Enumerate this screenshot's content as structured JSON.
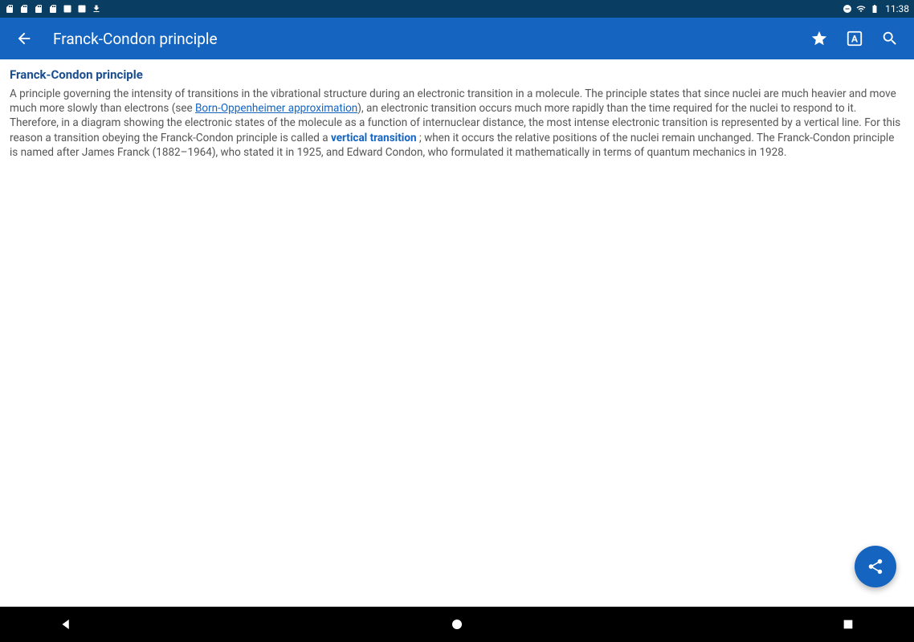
{
  "status_bar": {
    "time": "11:38"
  },
  "app_bar": {
    "title": "Franck-Condon principle"
  },
  "article": {
    "title": "Franck-Condon principle",
    "text_part1": "A principle governing the intensity of transitions in the vibrational structure during an electronic transition in a molecule. The principle states that since nuclei are much heavier and move much more slowly than electrons (see ",
    "link1": "Born-Oppenheimer approximation",
    "text_part2": "), an electronic transition occurs much more rapidly than the time required for the nuclei to respond to it. Therefore, in a diagram showing the electronic states of the molecule as a function of internuclear distance, the most intense electronic transition is represented by a vertical line. For this reason a transition obeying the Franck-Condon principle is called a ",
    "link2": "vertical transition",
    "text_part3": " ; when it occurs the relative positions of the nuclei remain unchanged. The Franck-Condon principle is named after James Franck (1882–1964), who stated it in 1925, and Edward Condon, who formulated it mathematically in terms of quantum mechanics in 1928."
  }
}
